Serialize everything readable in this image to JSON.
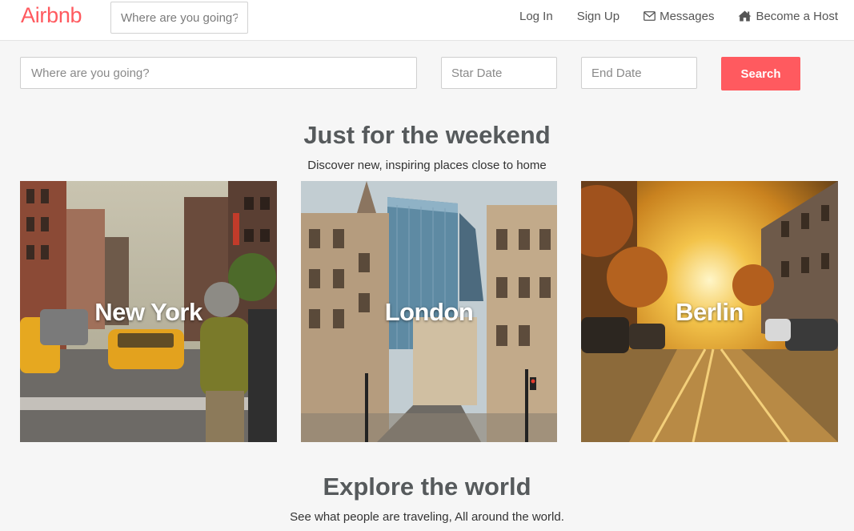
{
  "navbar": {
    "brand": "Airbnb",
    "search_placeholder": "Where are you going?",
    "links": {
      "login": "Log In",
      "signup": "Sign Up",
      "messages": "Messages",
      "host": "Become a Host"
    }
  },
  "search": {
    "where_placeholder": "Where are you going?",
    "start_placeholder": "Star Date",
    "end_placeholder": "End Date",
    "button_label": "Search"
  },
  "weekend": {
    "title": "Just for the weekend",
    "subtitle": "Discover new, inspiring places close to home",
    "cities": [
      "New York",
      "London",
      "Berlin"
    ]
  },
  "explore": {
    "title": "Explore the world",
    "subtitle": "See what people are traveling, All around the world."
  },
  "colors": {
    "brand": "#ff5a5f",
    "heading": "#565a5c",
    "background": "#f6f6f6"
  },
  "icons": {
    "messages": "envelope-icon",
    "host": "home-icon"
  }
}
